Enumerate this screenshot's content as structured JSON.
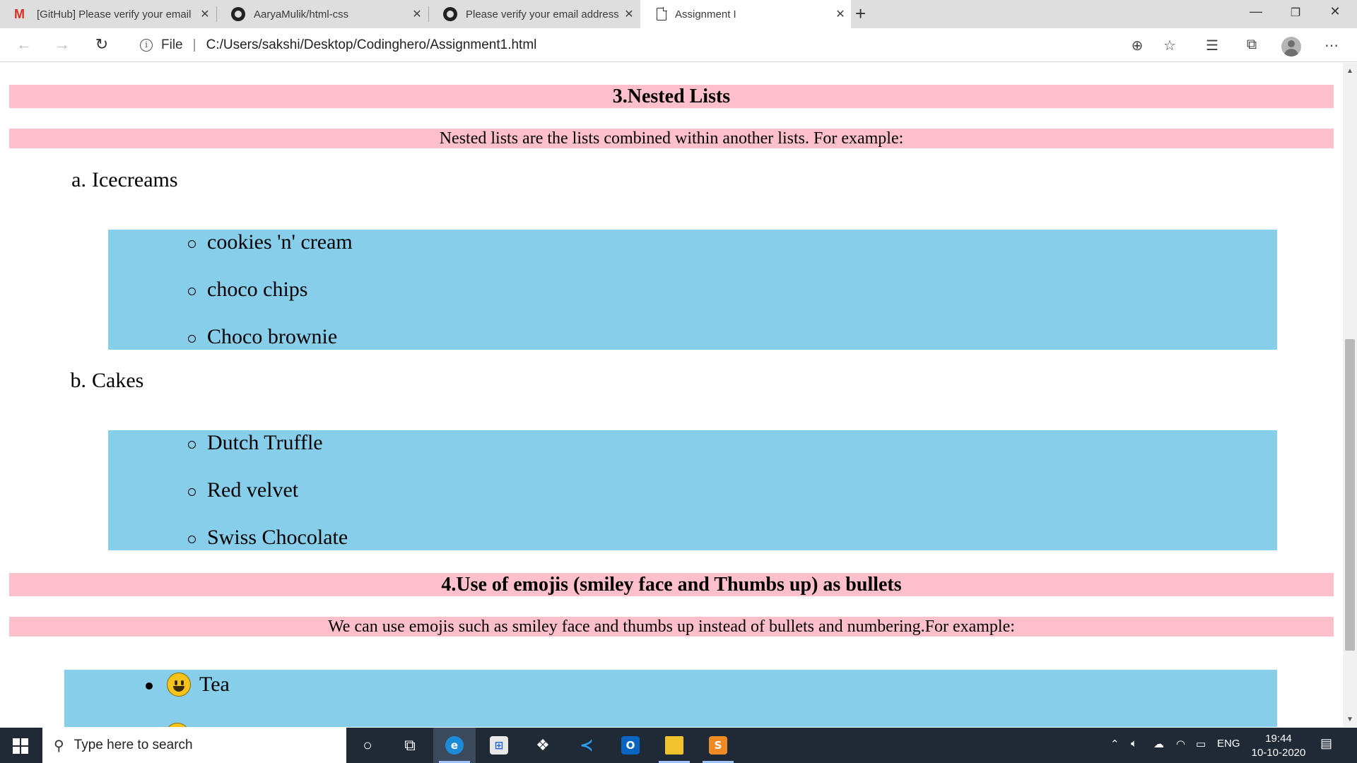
{
  "browser": {
    "tabs": [
      {
        "title": "[GitHub] Please verify your email",
        "icon": "gmail-icon"
      },
      {
        "title": "AaryaMulik/html-css",
        "icon": "github-icon"
      },
      {
        "title": "Please verify your email address",
        "icon": "github-icon"
      },
      {
        "title": "Assignment I",
        "icon": "document-icon",
        "active": true
      }
    ],
    "address": {
      "scheme_label": "File",
      "url": "C:/Users/sakshi/Desktop/Codinghero/Assignment1.html"
    }
  },
  "page": {
    "section3": {
      "heading": "3.Nested Lists",
      "intro": "Nested lists are the lists combined within another lists. For example:",
      "groups": [
        {
          "marker": "a.",
          "label": "Icecreams",
          "items": [
            "cookies 'n' cream",
            "choco chips",
            "Choco brownie"
          ]
        },
        {
          "marker": "b.",
          "label": "Cakes",
          "items": [
            "Dutch Truffle",
            "Red velvet",
            "Swiss Chocolate"
          ]
        }
      ]
    },
    "section4": {
      "heading": "4.Use of emojis (smiley face and Thumbs up) as bullets",
      "intro": "We can use emojis such as smiley face and thumbs up instead of bullets and numbering.For example:",
      "items": [
        "Tea"
      ]
    }
  },
  "colors": {
    "heading_bg": "#ffc0cb",
    "list_bg": "#87ceeb"
  },
  "taskbar": {
    "search_placeholder": "Type here to search",
    "language": "ENG",
    "time": "19:44",
    "date": "10-10-2020"
  }
}
